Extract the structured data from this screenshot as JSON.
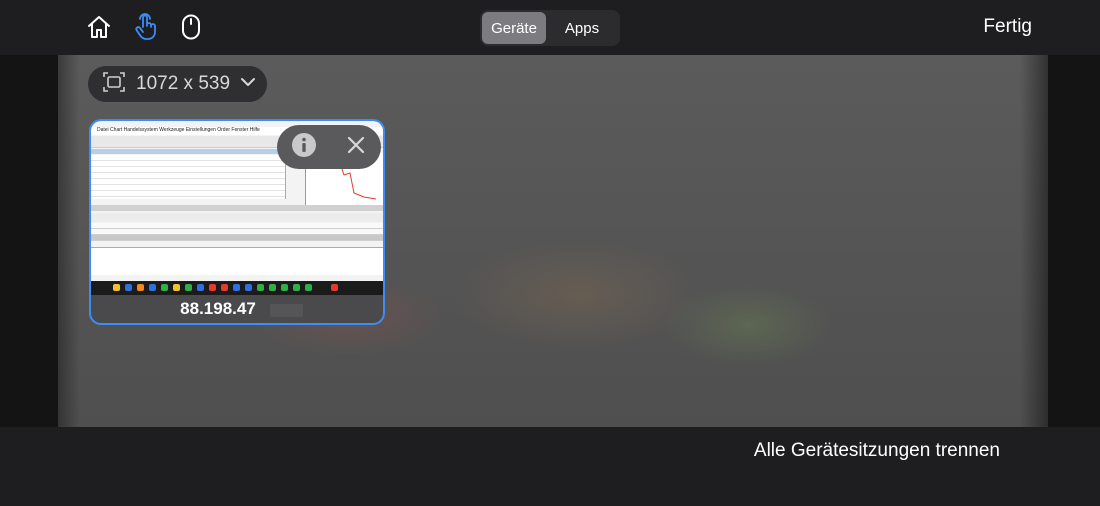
{
  "toolbar": {
    "icons": [
      "home-icon",
      "touch-pointer-icon",
      "mouse-icon"
    ],
    "active_icon": "touch-pointer-icon",
    "segments": [
      {
        "label": "Geräte",
        "active": true
      },
      {
        "label": "Apps",
        "active": false
      }
    ],
    "done_label": "Fertig"
  },
  "resolution": {
    "icon": "screen-size-icon",
    "label": "1072 x 539",
    "chevron": "chevron-down-icon"
  },
  "session_card": {
    "name": "88.198.47",
    "selected": true,
    "actions": [
      "info-icon",
      "close-icon"
    ],
    "thumbnail_menu": "Datei   Chart   Handelssystem   Werkzeuge   Einstellungen   Order   Fenster   Hilfe"
  },
  "footer": {
    "disconnect_all_label": "Alle Gerätesitzungen trennen"
  },
  "colors": {
    "accent_blue": "#3a8ef5",
    "bar_bg": "#1e1e20"
  }
}
